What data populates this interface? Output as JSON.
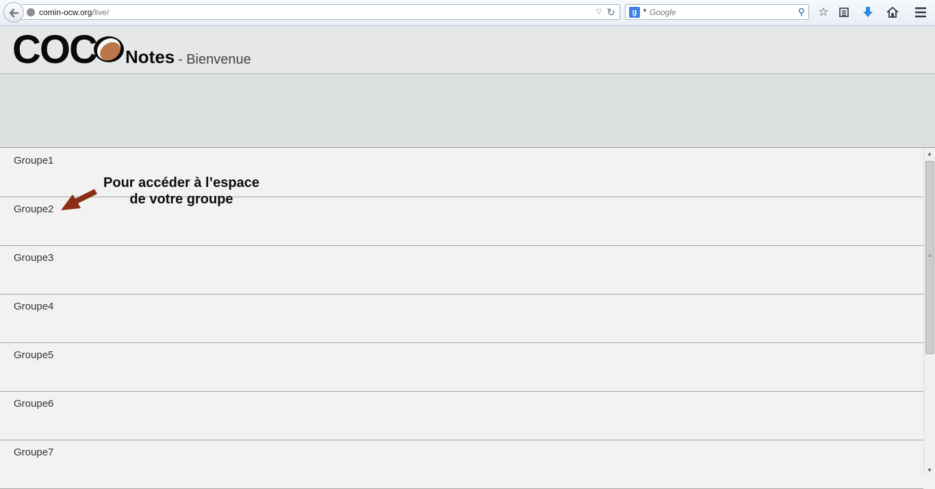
{
  "browser": {
    "url_host": "comin-ocw.org",
    "url_path": "/live/",
    "search_placeholder": "Google",
    "search_engine_icon": "g"
  },
  "header": {
    "logo_text": "COC",
    "logo_suffix": "Notes",
    "subtitle": "- Bienvenue"
  },
  "annotation": {
    "line1": "Pour accéder à l’espace",
    "line2": "de votre groupe",
    "arrow_color": "#8b2f14"
  },
  "groups": [
    {
      "label": "Groupe1"
    },
    {
      "label": "Groupe2"
    },
    {
      "label": "Groupe3"
    },
    {
      "label": "Groupe4"
    },
    {
      "label": "Groupe5"
    },
    {
      "label": "Groupe6"
    },
    {
      "label": "Groupe7"
    }
  ],
  "colors": {
    "header_bg": "#e6e8e7",
    "banner_bg": "#dcdfe0",
    "list_bg": "#f2f2f2",
    "coconut_flesh": "#b9774a"
  }
}
